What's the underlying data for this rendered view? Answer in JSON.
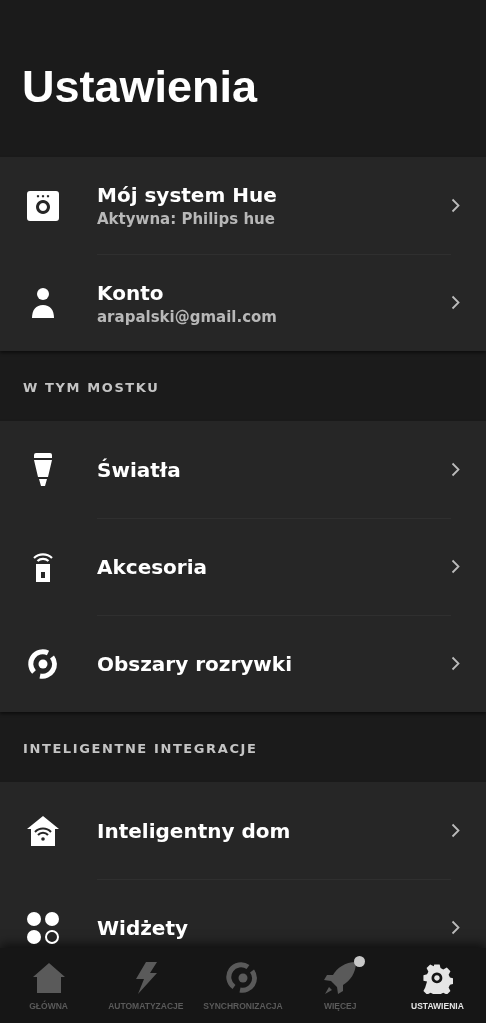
{
  "title": "Ustawienia",
  "sections": [
    {
      "items": [
        {
          "title": "Mój system Hue",
          "subtitle": "Aktywna: Philips hue"
        },
        {
          "title": "Konto",
          "subtitle": "arapalski@gmail.com"
        }
      ]
    },
    {
      "heading": "W TYM MOSTKU",
      "items": [
        {
          "title": "Światła"
        },
        {
          "title": "Akcesoria"
        },
        {
          "title": "Obszary rozrywki"
        }
      ]
    },
    {
      "heading": "INTELIGENTNE INTEGRACJE",
      "items": [
        {
          "title": "Inteligentny dom"
        },
        {
          "title": "Widżety"
        }
      ]
    }
  ],
  "nav": [
    {
      "label": "GŁÓWNA",
      "selected": false,
      "dot": false
    },
    {
      "label": "AUTOMATYZACJE",
      "selected": false,
      "dot": false
    },
    {
      "label": "SYNCHRONIZACJA",
      "selected": false,
      "dot": false
    },
    {
      "label": "WIĘCEJ",
      "selected": false,
      "dot": true
    },
    {
      "label": "USTAWIENIA",
      "selected": true,
      "dot": false
    }
  ]
}
